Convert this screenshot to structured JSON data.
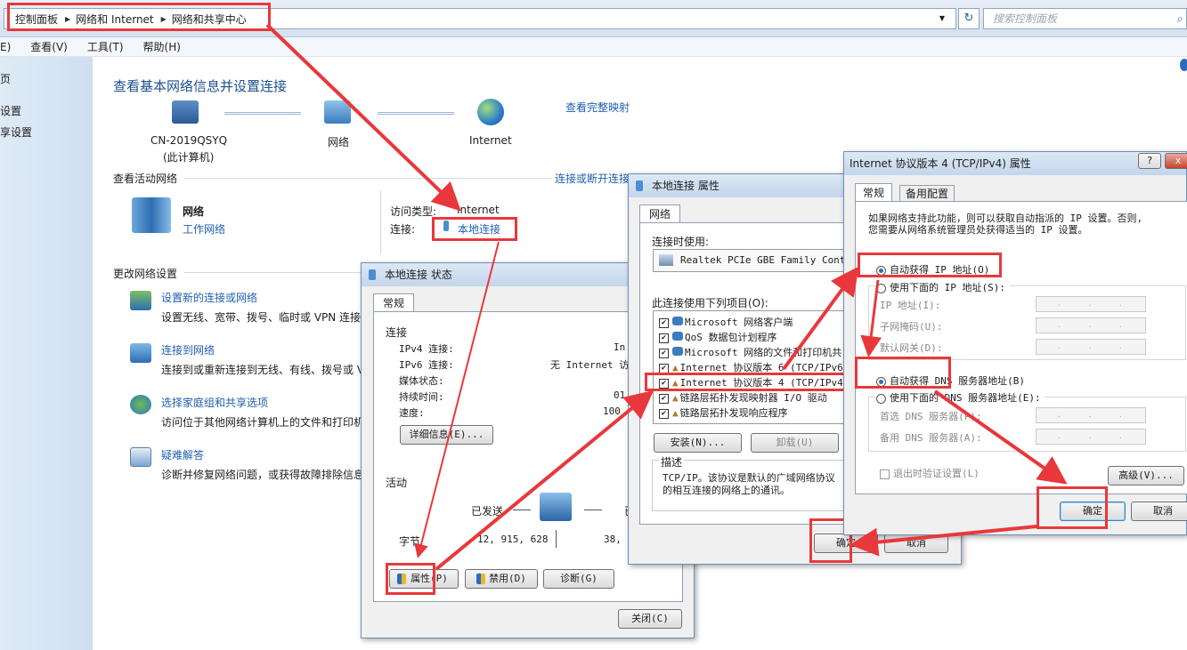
{
  "address": {
    "crumbs": [
      "控制面板",
      "网络和 Internet",
      "网络和共享中心"
    ],
    "refresh": "↻",
    "search_placeholder": "搜索控制面板"
  },
  "menu": {
    "edit": "E)",
    "view": "查看(V)",
    "tools": "工具(T)",
    "help": "帮助(H)"
  },
  "leftpane": {
    "item1": "页",
    "item2": "设置",
    "item3": "享设置"
  },
  "main": {
    "title": "查看基本网络信息并设置连接",
    "map": {
      "computer_name": "CN-2019QSYQ",
      "computer_sub": "(此计算机)",
      "network": "网络",
      "internet": "Internet",
      "view_full": "查看完整映射"
    },
    "active_label": "查看活动网络",
    "connect_link": "连接或断开连接",
    "net_name": "网络",
    "net_type": "工作网络",
    "access_label": "访问类型:",
    "access_value": "Internet",
    "conn_label": "连接:",
    "conn_value": "本地连接",
    "change_label": "更改网络设置",
    "tasks": [
      {
        "title": "设置新的连接或网络",
        "desc": "设置无线、宽带、拨号、临时或 VPN 连接"
      },
      {
        "title": "连接到网络",
        "desc": "连接到或重新连接到无线、有线、拨号或 V"
      },
      {
        "title": "选择家庭组和共享选项",
        "desc": "访问位于其他网络计算机上的文件和打印机"
      },
      {
        "title": "疑难解答",
        "desc": "诊断并修复网络问题，或获得故障排除信息"
      }
    ]
  },
  "status_win": {
    "title": "本地连接 状态",
    "tab": "常规",
    "conn_group": "连接",
    "rows": [
      {
        "label": "IPv4 连接:",
        "value": "In"
      },
      {
        "label": "IPv6 连接:",
        "value": "无 Internet 访问"
      },
      {
        "label": "媒体状态:",
        "value": ""
      },
      {
        "label": "持续时间:",
        "value": "01"
      },
      {
        "label": "速度:",
        "value": "100"
      }
    ],
    "details_btn": "详细信息(E)...",
    "activity_group": "活动",
    "sent": "已发送",
    "recv_prefix": "已",
    "bytes_label": "字节",
    "bytes_sent": "12, 915, 628",
    "bytes_recv": "38, 18",
    "prop_btn": "属性(P)",
    "disable_btn": "禁用(D)",
    "diag_btn": "诊断(G)",
    "close_btn": "关闭(C)"
  },
  "props_win": {
    "title": "本地连接 属性",
    "tab": "网络",
    "connect_using": "连接时使用:",
    "adapter": "Realtek PCIe GBE Family Contro",
    "items_label": "此连接使用下列项目(O):",
    "items": [
      "Microsoft 网络客户端",
      "QoS 数据包计划程序",
      "Microsoft 网络的文件和打印机共",
      "Internet 协议版本 6 (TCP/IPv6",
      "Internet 协议版本 4 (TCP/IPv4",
      "链路层拓扑发现映射器 I/O 驱动",
      "链路层拓扑发现响应程序"
    ],
    "install_btn": "安装(N)...",
    "uninstall_btn": "卸载(U)",
    "desc_label": "描述",
    "desc_text1": "TCP/IP。该协议是默认的广域网络协议",
    "desc_text2": "的相互连接的网络上的通讯。",
    "ok_btn": "确定",
    "cancel_btn": "取消"
  },
  "ipv4_win": {
    "title": "Internet 协议版本 4 (TCP/IPv4) 属性",
    "help": "?",
    "close": "x",
    "tab_general": "常规",
    "tab_alt": "备用配置",
    "intro1": "如果网络支持此功能，则可以获取自动指派的 IP 设置。否则,",
    "intro2": "您需要从网络系统管理员处获得适当的 IP 设置。",
    "auto_ip": "自动获得 IP 地址(O)",
    "manual_ip": "使用下面的 IP 地址(S):",
    "ip_addr": "IP 地址(I):",
    "subnet": "子网掩码(U):",
    "gateway": "默认网关(D):",
    "auto_dns": "自动获得 DNS 服务器地址(B)",
    "manual_dns": "使用下面的 DNS 服务器地址(E):",
    "pref_dns": "首选 DNS 服务器(P):",
    "alt_dns": "备用 DNS 服务器(A):",
    "validate": "退出时验证设置(L)",
    "advanced_btn": "高级(V)...",
    "ok_btn": "确定",
    "cancel_btn": "取消",
    "ip_dots": ". . ."
  }
}
